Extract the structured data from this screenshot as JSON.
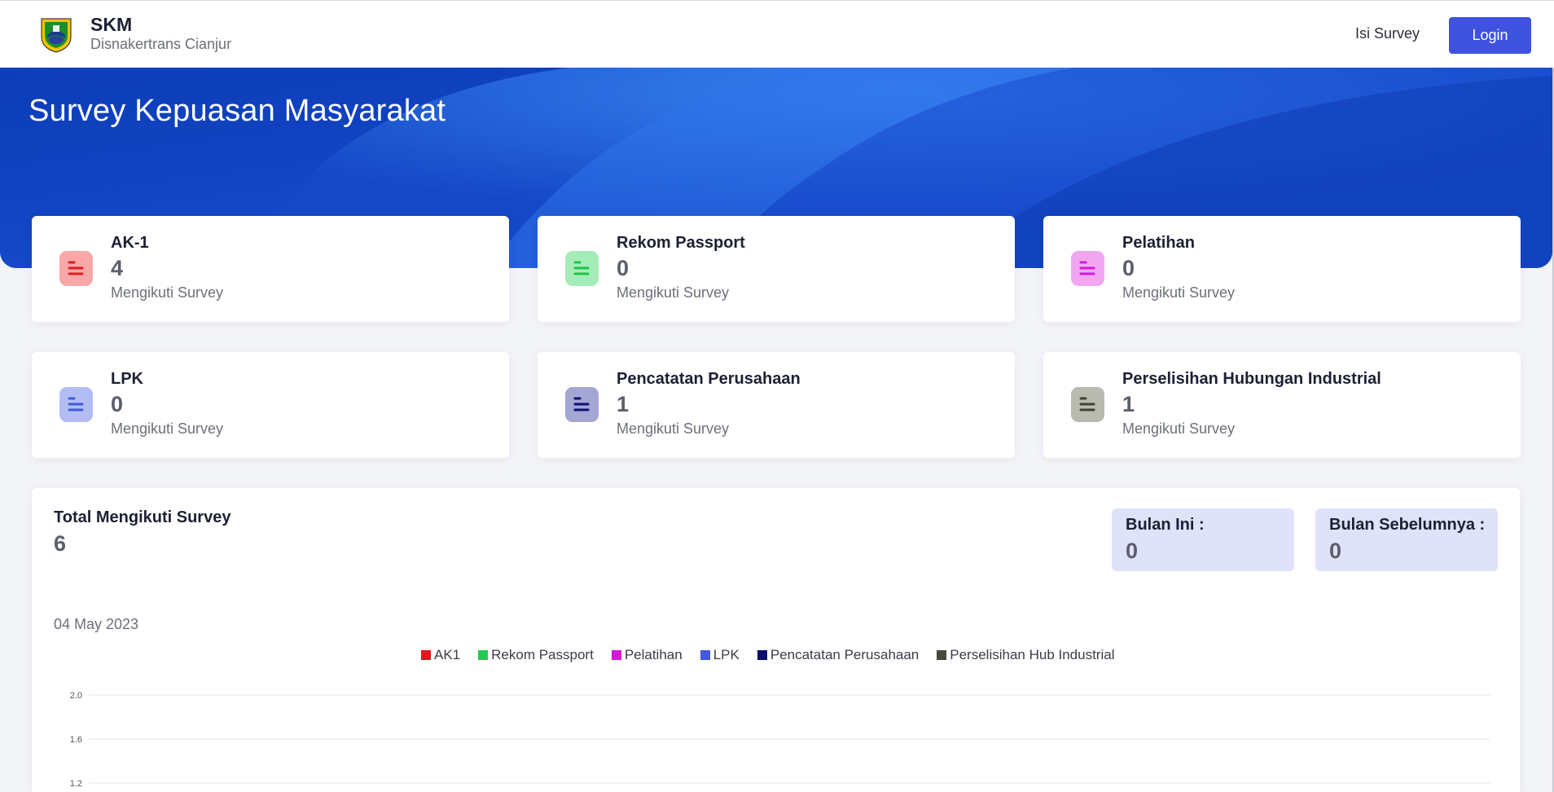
{
  "navbar": {
    "brand_title": "SKM",
    "brand_subtitle": "Disnakertrans Cianjur",
    "nav_link": "Isi Survey",
    "login_label": "Login"
  },
  "hero": {
    "title": "Survey Kepuasan Masyarakat"
  },
  "cards": [
    {
      "name": "AK-1",
      "count": "4",
      "sub": "Mengikuti Survey",
      "color": "#e11d1d",
      "bg": "#f9a7a7"
    },
    {
      "name": "Rekom Passport",
      "count": "0",
      "sub": "Mengikuti Survey",
      "color": "#1cc44a",
      "bg": "#a6ecb9"
    },
    {
      "name": "Pelatihan",
      "count": "0",
      "sub": "Mengikuti Survey",
      "color": "#d11bd6",
      "bg": "#f1a6f1"
    },
    {
      "name": "LPK",
      "count": "0",
      "sub": "Mengikuti Survey",
      "color": "#3f5ae0",
      "bg": "#b3bdf4"
    },
    {
      "name": "Pencatatan Perusahaan",
      "count": "1",
      "sub": "Mengikuti Survey",
      "color": "#0d0f6f",
      "bg": "#a4a6d4"
    },
    {
      "name": "Perselisihan Hubungan Industrial",
      "count": "1",
      "sub": "Mengikuti Survey",
      "color": "#3f4234",
      "bg": "#b9bab0"
    }
  ],
  "summary": {
    "total_label": "Total Mengikuti Survey",
    "total_value": "6",
    "this_month_label": "Bulan Ini :",
    "this_month_value": "0",
    "prev_month_label": "Bulan Sebelumnya :",
    "prev_month_value": "0"
  },
  "chart_data": {
    "type": "bar",
    "date_label": "04 May 2023",
    "series": [
      {
        "name": "AK1",
        "color": "#e3161b"
      },
      {
        "name": "Rekom Passport",
        "color": "#1ecb4f"
      },
      {
        "name": "Pelatihan",
        "color": "#d517d8"
      },
      {
        "name": "LPK",
        "color": "#3f5ae0"
      },
      {
        "name": "Pencatatan Perusahaan",
        "color": "#0a0c6e"
      },
      {
        "name": "Perselisihan Hub Industrial",
        "color": "#474a3a"
      }
    ],
    "yticks": [
      "2.0",
      "1.6",
      "1.2"
    ],
    "grid": true,
    "legend_position": "top-center"
  }
}
